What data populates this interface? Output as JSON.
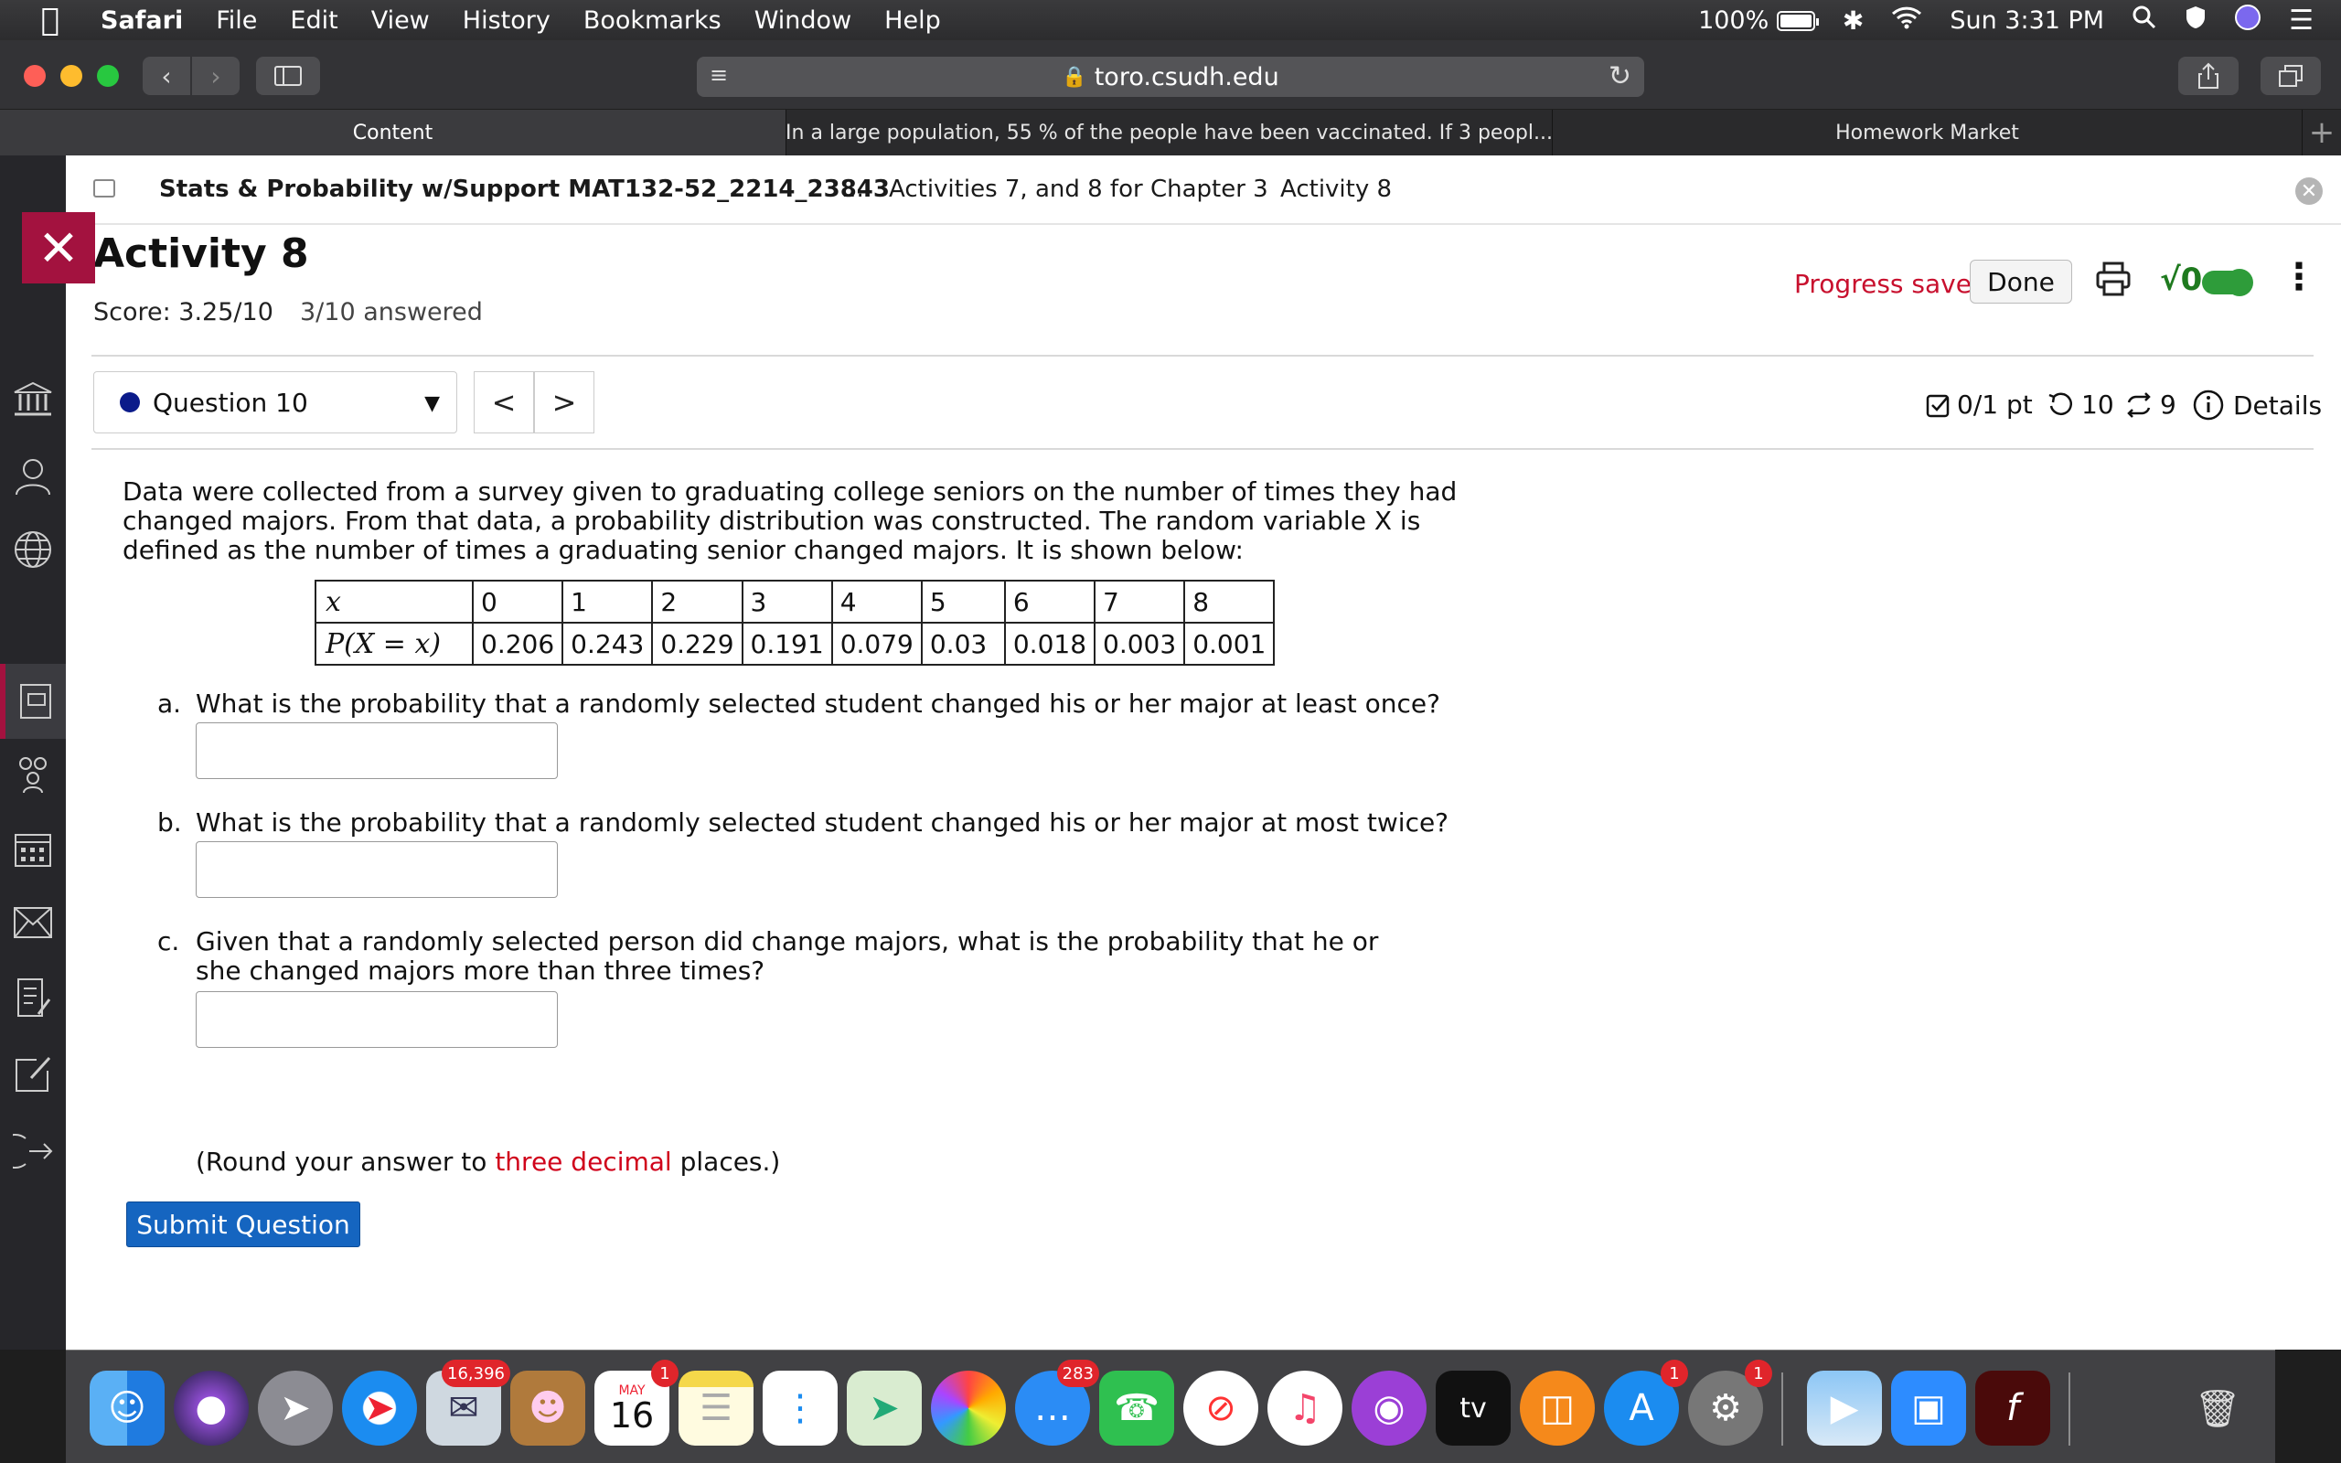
{
  "menubar": {
    "apple": "",
    "app": "Safari",
    "items": [
      "File",
      "Edit",
      "View",
      "History",
      "Bookmarks",
      "Window",
      "Help"
    ],
    "battery": "100%",
    "clock": "Sun 3:31 PM"
  },
  "browser": {
    "url": "toro.csudh.edu",
    "tabs": [
      "Content",
      "In a large population, 55 % of the people have been vaccinated. If 3 peopl...",
      "Homework Market"
    ]
  },
  "breadcrumbs": {
    "course": "Stats & Probability w/Support MAT132-52_2214_23843",
    "ellipsis": "...",
    "chapter": "Activities 7, and 8 for Chapter 3",
    "activity": "Activity 8"
  },
  "header": {
    "title": "Activity 8",
    "score": "Score: 3.25/10",
    "answered": "3/10 answered",
    "progress": "Progress saved",
    "done": "Done",
    "math_icon": "√0"
  },
  "question_nav": {
    "selected": "Question 10",
    "prev": "<",
    "next": ">"
  },
  "meta": {
    "points": "0/1 pt",
    "retries": "10",
    "attempts": "9",
    "details": "Details"
  },
  "question": {
    "stem": "Data were collected from a survey given to graduating college seniors on the number of times they had changed majors. From that data, a probability distribution was constructed. The random variable X is defined as the number of times a graduating senior changed majors. It is shown below:",
    "table": {
      "x_header": "x",
      "p_header": "P(X = x)",
      "x": [
        "0",
        "1",
        "2",
        "3",
        "4",
        "5",
        "6",
        "7",
        "8"
      ],
      "p": [
        "0.206",
        "0.243",
        "0.229",
        "0.191",
        "0.079",
        "0.03",
        "0.018",
        "0.003",
        "0.001"
      ]
    },
    "parts": [
      {
        "label": "a.",
        "text": "What is the probability that a randomly selected student changed his or her major at least once?"
      },
      {
        "label": "b.",
        "text": "What is the probability that a randomly selected student changed his or her major at most twice?"
      },
      {
        "label": "c.",
        "text": "Given that a randomly selected person did change majors, what is the probability that he or she changed majors more than three times?"
      }
    ],
    "note_pre": "(Round your answer to ",
    "note_red": "three decimal",
    "note_post": " places.)",
    "submit": "Submit Question"
  },
  "dock": {
    "mail_badge": "16,396",
    "calendar_month": "MAY",
    "calendar_day": "16",
    "calendar_badge": "1",
    "messages_badge": "283",
    "appstore_badge": "1",
    "prefs_badge": "1",
    "tv_label": "tv"
  },
  "colors": {
    "accent_red": "#a3123f",
    "progress_red": "#c8102e",
    "submit_blue": "#1565c0",
    "question_dot": "#0b1b8a"
  }
}
